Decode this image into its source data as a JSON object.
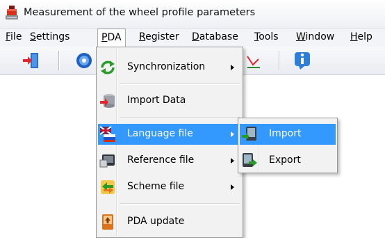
{
  "window": {
    "title": "Measurement of the wheel profile parameters",
    "icon": "wheel-app-icon"
  },
  "menubar": {
    "items": [
      {
        "label": "File",
        "mnemonic": "F",
        "rest": "ile"
      },
      {
        "label": "Settings",
        "mnemonic": "S",
        "rest": "ettings"
      },
      {
        "label": "PDA",
        "mnemonic": "P",
        "rest": "DA",
        "state": "open"
      },
      {
        "label": "Register",
        "mnemonic": "R",
        "rest": "egister"
      },
      {
        "label": "Database",
        "mnemonic": "D",
        "rest": "atabase"
      },
      {
        "label": "Tools",
        "mnemonic": "T",
        "rest": "ools"
      },
      {
        "label": "Window",
        "mnemonic": "W",
        "rest": "indow"
      },
      {
        "label": "Help",
        "mnemonic": "H",
        "rest": "elp"
      }
    ]
  },
  "toolbar": {
    "buttons": [
      "exit-icon",
      "settings-gear-icon",
      "graph-icon",
      "info-icon"
    ]
  },
  "pda_menu": {
    "items": [
      {
        "label": "Synchronization",
        "icon": "sync-arrows-icon",
        "submenu": true
      },
      {
        "label": "Import Data",
        "icon": "database-import-icon",
        "submenu": false
      },
      {
        "label": "Language file",
        "icon": "language-flags-icon",
        "submenu": true,
        "highlighted": true
      },
      {
        "label": "Reference file",
        "icon": "reference-file-icon",
        "submenu": true
      },
      {
        "label": "Scheme file",
        "icon": "scheme-file-icon",
        "submenu": true
      },
      {
        "label": "PDA update",
        "icon": "pda-update-icon",
        "submenu": false
      }
    ]
  },
  "language_submenu": {
    "items": [
      {
        "label": "Import",
        "icon": "pda-import-icon",
        "highlighted": true
      },
      {
        "label": "Export",
        "icon": "pda-export-icon"
      }
    ]
  },
  "colors": {
    "highlight": "#3399ff",
    "menu_bg": "#f2f2f2",
    "menu_border": "#979797"
  }
}
